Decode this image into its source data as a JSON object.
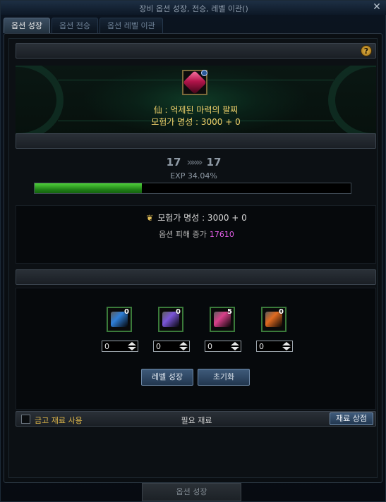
{
  "window": {
    "title": "장비 옵션 성장, 전승, 레벨 이관()",
    "close_glyph": "✕"
  },
  "tabs": [
    {
      "label": "옵션 성장",
      "active": true
    },
    {
      "label": "옵션 전승",
      "active": false
    },
    {
      "label": "옵션 레벨 이관",
      "active": false
    }
  ],
  "help_glyph": "?",
  "item": {
    "icon": "bracelet-gem-icon",
    "name": "仙 : 억제된 마력의 팔찌",
    "fame": "모험가 명성 : 3000 + 0"
  },
  "level": {
    "current": "17",
    "arrow": "»»»",
    "next": "17",
    "exp_text": "EXP 34.04%",
    "exp_fraction": 0.3404
  },
  "stats": {
    "fame_icon": "fame-icon",
    "fame_text": "모험가 명성 : 3000 + 0",
    "damage_label": "옵션 피해 증가",
    "damage_value": "17610"
  },
  "materials": [
    {
      "icon": "blue-cube-icon",
      "color": "#2f7fd8",
      "count": "0",
      "input": "0"
    },
    {
      "icon": "purple-cube-icon",
      "color": "#7a55d8",
      "count": "0",
      "input": "0"
    },
    {
      "icon": "pink-cube-icon",
      "color": "#d8408a",
      "count": "5",
      "input": "0"
    },
    {
      "icon": "orange-cube-icon",
      "color": "#e06a20",
      "count": "0",
      "input": "0"
    }
  ],
  "buttons": {
    "level_up": "레벨 성장",
    "reset": "초기화"
  },
  "footer": {
    "checkbox_label": "금고 재료 사용",
    "required_label": "필요 재료",
    "shop_button": "재료 상점"
  },
  "bottom_button": "옵션 성장",
  "colors": {
    "accent_gold": "#f2d36b",
    "exp_green": "#4fd03a",
    "damage_pink": "#e35ee8"
  }
}
